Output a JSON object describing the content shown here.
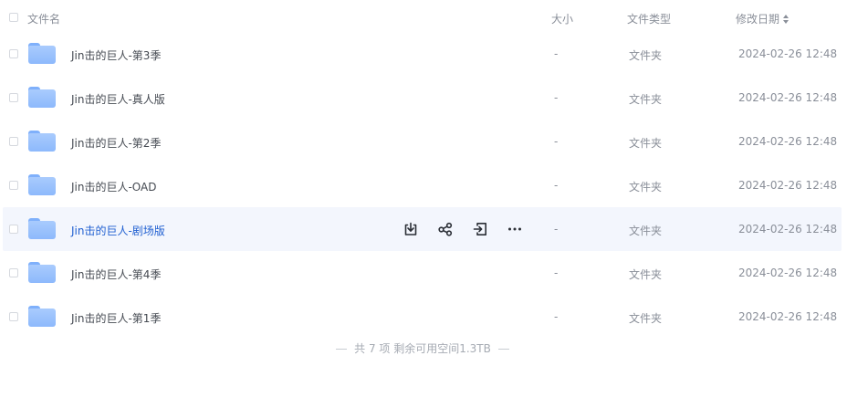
{
  "header": {
    "name": "文件名",
    "size": "大小",
    "type": "文件类型",
    "date": "修改日期"
  },
  "rows": [
    {
      "name": "Jin击的巨人-第3季",
      "size": "-",
      "type": "文件夹",
      "date": "2024-02-26 12:48"
    },
    {
      "name": "Jin击的巨人-真人版",
      "size": "-",
      "type": "文件夹",
      "date": "2024-02-26 12:48"
    },
    {
      "name": "Jin击的巨人-第2季",
      "size": "-",
      "type": "文件夹",
      "date": "2024-02-26 12:48"
    },
    {
      "name": "Jin击的巨人-OAD",
      "size": "-",
      "type": "文件夹",
      "date": "2024-02-26 12:48"
    },
    {
      "name": "Jin击的巨人-剧场版",
      "size": "-",
      "type": "文件夹",
      "date": "2024-02-26 12:48"
    },
    {
      "name": "Jin击的巨人-第4季",
      "size": "-",
      "type": "文件夹",
      "date": "2024-02-26 12:48"
    },
    {
      "name": "Jin击的巨人-第1季",
      "size": "-",
      "type": "文件夹",
      "date": "2024-02-26 12:48"
    }
  ],
  "hover_actions": [
    "download-icon",
    "share-icon",
    "move-icon",
    "more-icon"
  ],
  "footer": {
    "summary": "共 7 项 剩余可用空间1.3TB"
  },
  "colors": {
    "hover_row_bg": "#f3f6fd",
    "link_blue": "#1f5fd1",
    "folder_blue": "#8db9fc"
  }
}
